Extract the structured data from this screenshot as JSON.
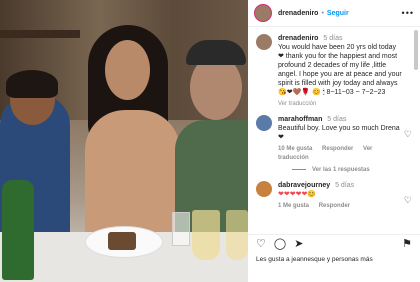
{
  "header": {
    "username": "drenadeniro",
    "follow_label": "Seguir",
    "more_label": "•••"
  },
  "comments": [
    {
      "username": "drenadeniro",
      "time": "5 días",
      "text": "You would have been 20 yrs old today ❤ thank you for the happiest and most profound 2 decades of my life ,little angel. I hope you are at peace and your spirit is filled with joy today and always 😘❤🤎🌹 😊 🕯 8~11~03 ~ 7~2~23"
    },
    {
      "username": "ver_traduccion",
      "text": "Ver traducción"
    },
    {
      "username": "marahoffman",
      "time": "5 días",
      "text": "Beautiful boy. Love you so much Drena ❤",
      "likes": "10 Me gusta",
      "reply": "Responder",
      "translate": "Ver traducción"
    },
    {
      "username": "dabravejourney",
      "time": "5 días",
      "text": "❤❤❤❤❤😊",
      "likes": "1 Me gusta",
      "reply": "Responder"
    }
  ],
  "replies_label": "Ver las 1 respuestas",
  "footer": {
    "likes_text": "Les gusta a jeannesque y personas más"
  },
  "icons": [
    "heart-icon",
    "comment-icon",
    "share-icon",
    "bookmark-icon"
  ]
}
